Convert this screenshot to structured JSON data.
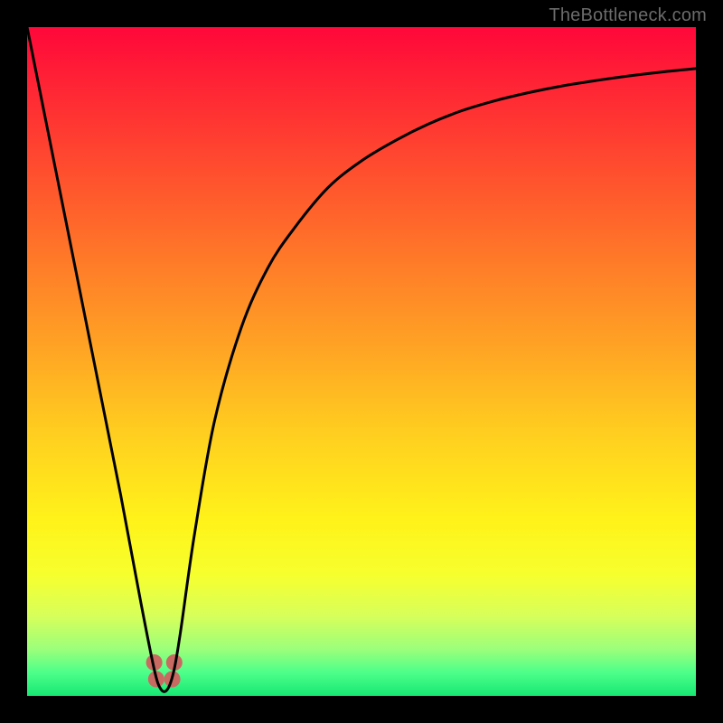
{
  "watermark": "TheBottleneck.com",
  "chart_data": {
    "type": "line",
    "title": "",
    "xlabel": "",
    "ylabel": "",
    "xlim": [
      0,
      100
    ],
    "ylim": [
      0,
      100
    ],
    "grid": false,
    "legend": false,
    "series": [
      {
        "name": "bottleneck-curve",
        "x": [
          0,
          5,
          10,
          14,
          17,
          19,
          20,
          21,
          22,
          23,
          25,
          28,
          32,
          36,
          40,
          45,
          50,
          55,
          60,
          65,
          70,
          75,
          80,
          85,
          90,
          95,
          100
        ],
        "values": [
          100,
          75,
          50,
          30,
          14,
          4,
          1,
          1,
          4,
          10,
          24,
          41,
          55,
          64,
          70,
          76,
          80,
          83,
          85.5,
          87.5,
          89,
          90.2,
          91.2,
          92,
          92.7,
          93.3,
          93.8
        ]
      }
    ],
    "gradient_stops": [
      {
        "pos": 0.0,
        "color": "#ff073a"
      },
      {
        "pos": 0.12,
        "color": "#ff2f33"
      },
      {
        "pos": 0.3,
        "color": "#ff6a2a"
      },
      {
        "pos": 0.48,
        "color": "#ffa424"
      },
      {
        "pos": 0.62,
        "color": "#ffd21f"
      },
      {
        "pos": 0.74,
        "color": "#fff31a"
      },
      {
        "pos": 0.82,
        "color": "#f6ff2e"
      },
      {
        "pos": 0.88,
        "color": "#d7ff5a"
      },
      {
        "pos": 0.93,
        "color": "#9cff7a"
      },
      {
        "pos": 0.965,
        "color": "#4dff8a"
      },
      {
        "pos": 1.0,
        "color": "#16e873"
      }
    ],
    "curve_color": "#000000",
    "curve_width": 3,
    "markers": [
      {
        "x": 19.0,
        "y": 5.0
      },
      {
        "x": 19.3,
        "y": 2.5
      },
      {
        "x": 21.7,
        "y": 2.5
      },
      {
        "x": 22.0,
        "y": 5.0
      }
    ],
    "marker_color": "#c96a62",
    "marker_radius": 9
  }
}
